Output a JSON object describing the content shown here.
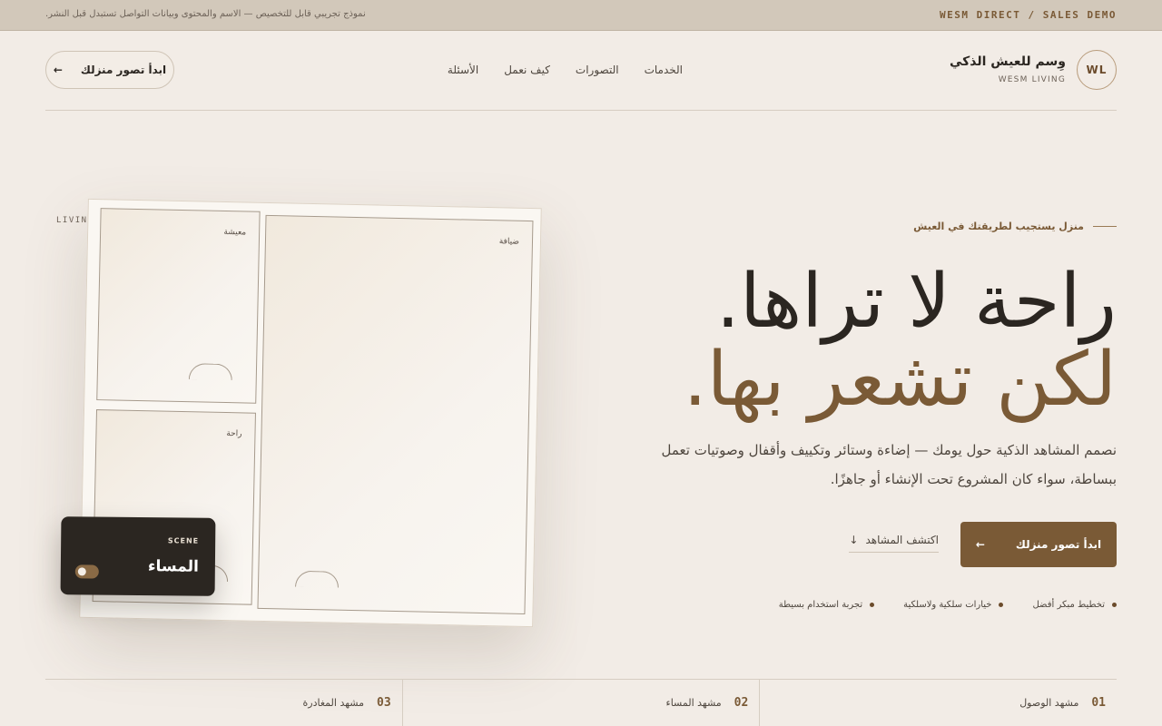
{
  "topbar": {
    "brand": "WESM DIRECT / SALES DEMO",
    "note": "نموذج تجريبي قابل للتخصيص — الاسم والمحتوى وبيانات التواصل تستبدل قبل النشر."
  },
  "header": {
    "logo_badge": "WL",
    "logo_name": "وِسم للعيش الذكي",
    "logo_sub": "WESM LIVING",
    "nav": [
      "الخدمات",
      "التصورات",
      "كيف نعمل",
      "الأسئلة"
    ],
    "cta_label": "ابدأ تصور منزلك",
    "cta_arrow": "←"
  },
  "hero": {
    "eyebrow": "منزل يستجيب لطريقتك في العيش",
    "title_line1": "راحة لا تراها.",
    "title_line2": "لكن تشعر بها.",
    "lead": "نصمم المشاهد الذكية حول يومك — إضاءة وستائر وتكييف وأقفال وصوتيات تعمل ببساطة، سواء كان المشروع تحت الإنشاء أو جاهزًا.",
    "primary_label": "ابدأ تصور منزلك",
    "primary_arrow": "←",
    "secondary_label": "اكتشف المشاهد",
    "secondary_arrow": "↓",
    "features": [
      "تخطيط مبكر أفضل",
      "خيارات سلكية ولاسلكية",
      "تجربة استخدام بسيطة"
    ]
  },
  "visual": {
    "side_label": "LIVING",
    "rooms": {
      "guest": "ضيافة",
      "living": "معيشة",
      "rest": "راحة"
    },
    "scene_card": {
      "tag": "SCENE",
      "name": "المساء",
      "toggle_on": true
    }
  },
  "scenes": [
    {
      "num": "01",
      "label": "مشهد الوصول"
    },
    {
      "num": "02",
      "label": "مشهد المساء"
    },
    {
      "num": "03",
      "label": "مشهد المغادرة"
    }
  ],
  "colors": {
    "accent": "#7a5a36",
    "background": "#f2ece6",
    "topbar": "#d2c8ba",
    "dark": "#2b2621"
  }
}
